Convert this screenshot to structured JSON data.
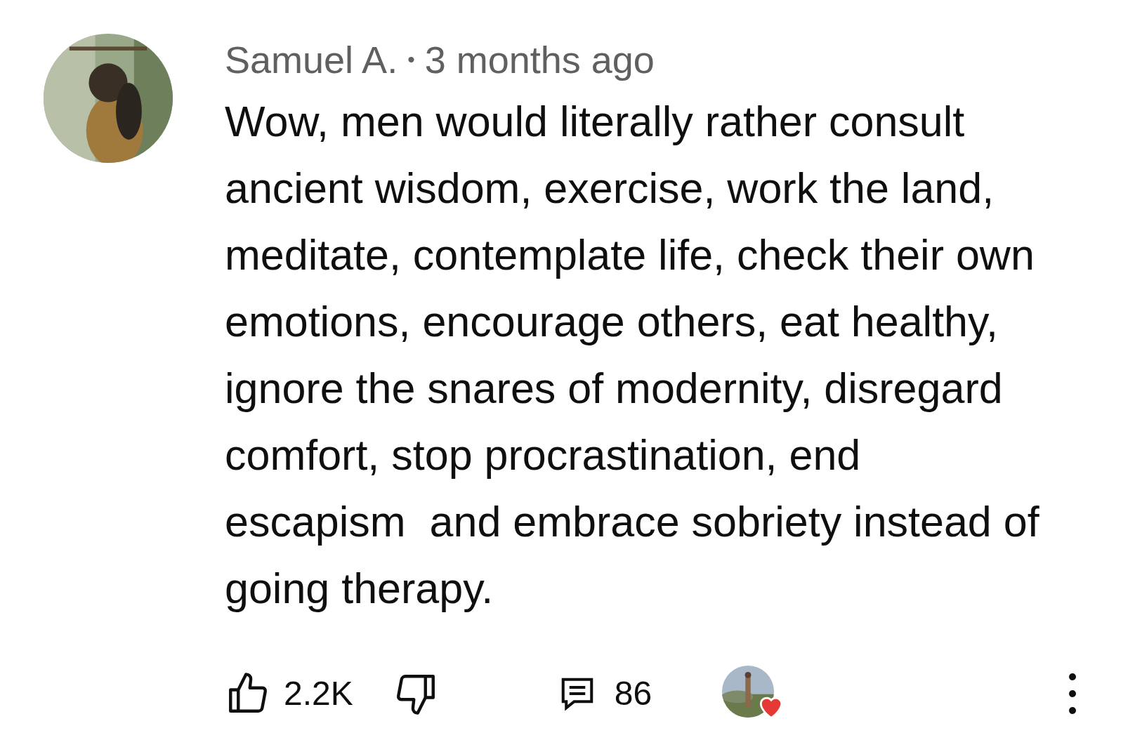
{
  "comment": {
    "author": "Samuel A.",
    "separator": "•",
    "time": "3 months ago",
    "text": "Wow, men would literally rather consult ancient wisdom, exercise, work the land, meditate, contemplate life, check their own emotions, encourage others, eat healthy, ignore the snares of modernity, disregard comfort, stop procrastination, end escapism  and embrace sobriety instead of going therapy.",
    "likes": "2.2K",
    "replies": "86",
    "creator_hearted": true
  }
}
